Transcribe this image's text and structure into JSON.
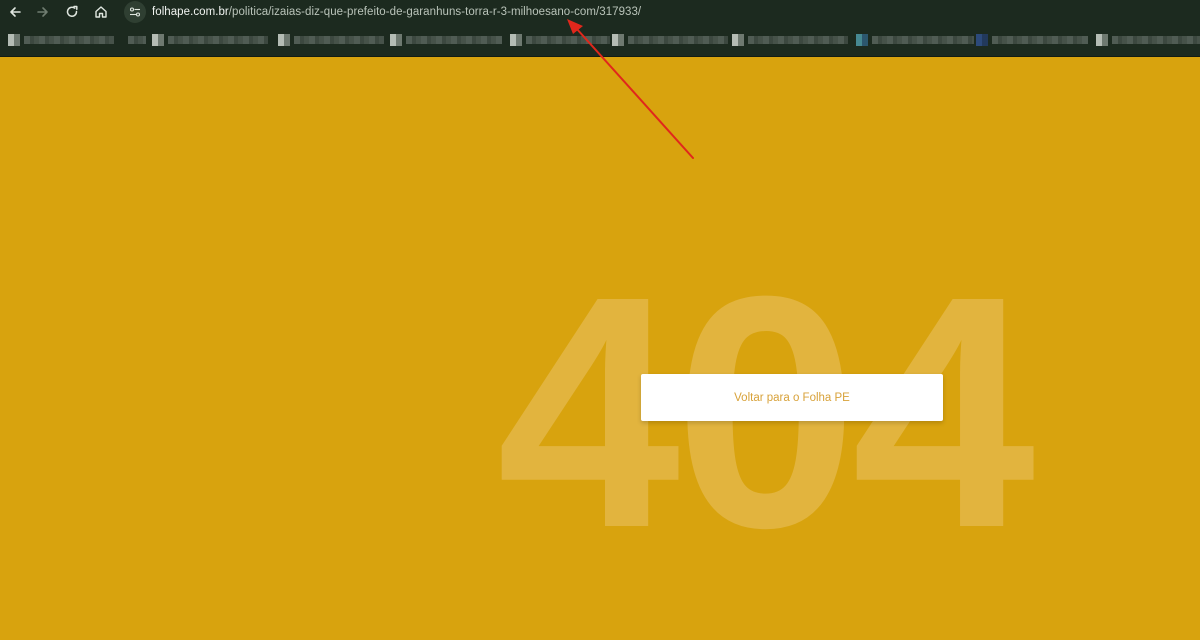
{
  "browser": {
    "url_host": "folhape.com.br",
    "url_path": "/politica/izaias-diz-que-prefeito-de-garanhuns-torra-r-3-milhoesano-com/317933/"
  },
  "page": {
    "background_color": "#d8a30e",
    "error_code": "404",
    "back_button_label": "Voltar para o Folha PE"
  },
  "annotation": {
    "type": "arrow",
    "color": "#e0271c",
    "points_to": "address-bar-url"
  },
  "icons": [
    "back-arrow-icon",
    "forward-arrow-icon",
    "reload-icon",
    "home-icon",
    "site-settings-icon",
    "red-arrow-annotation"
  ]
}
